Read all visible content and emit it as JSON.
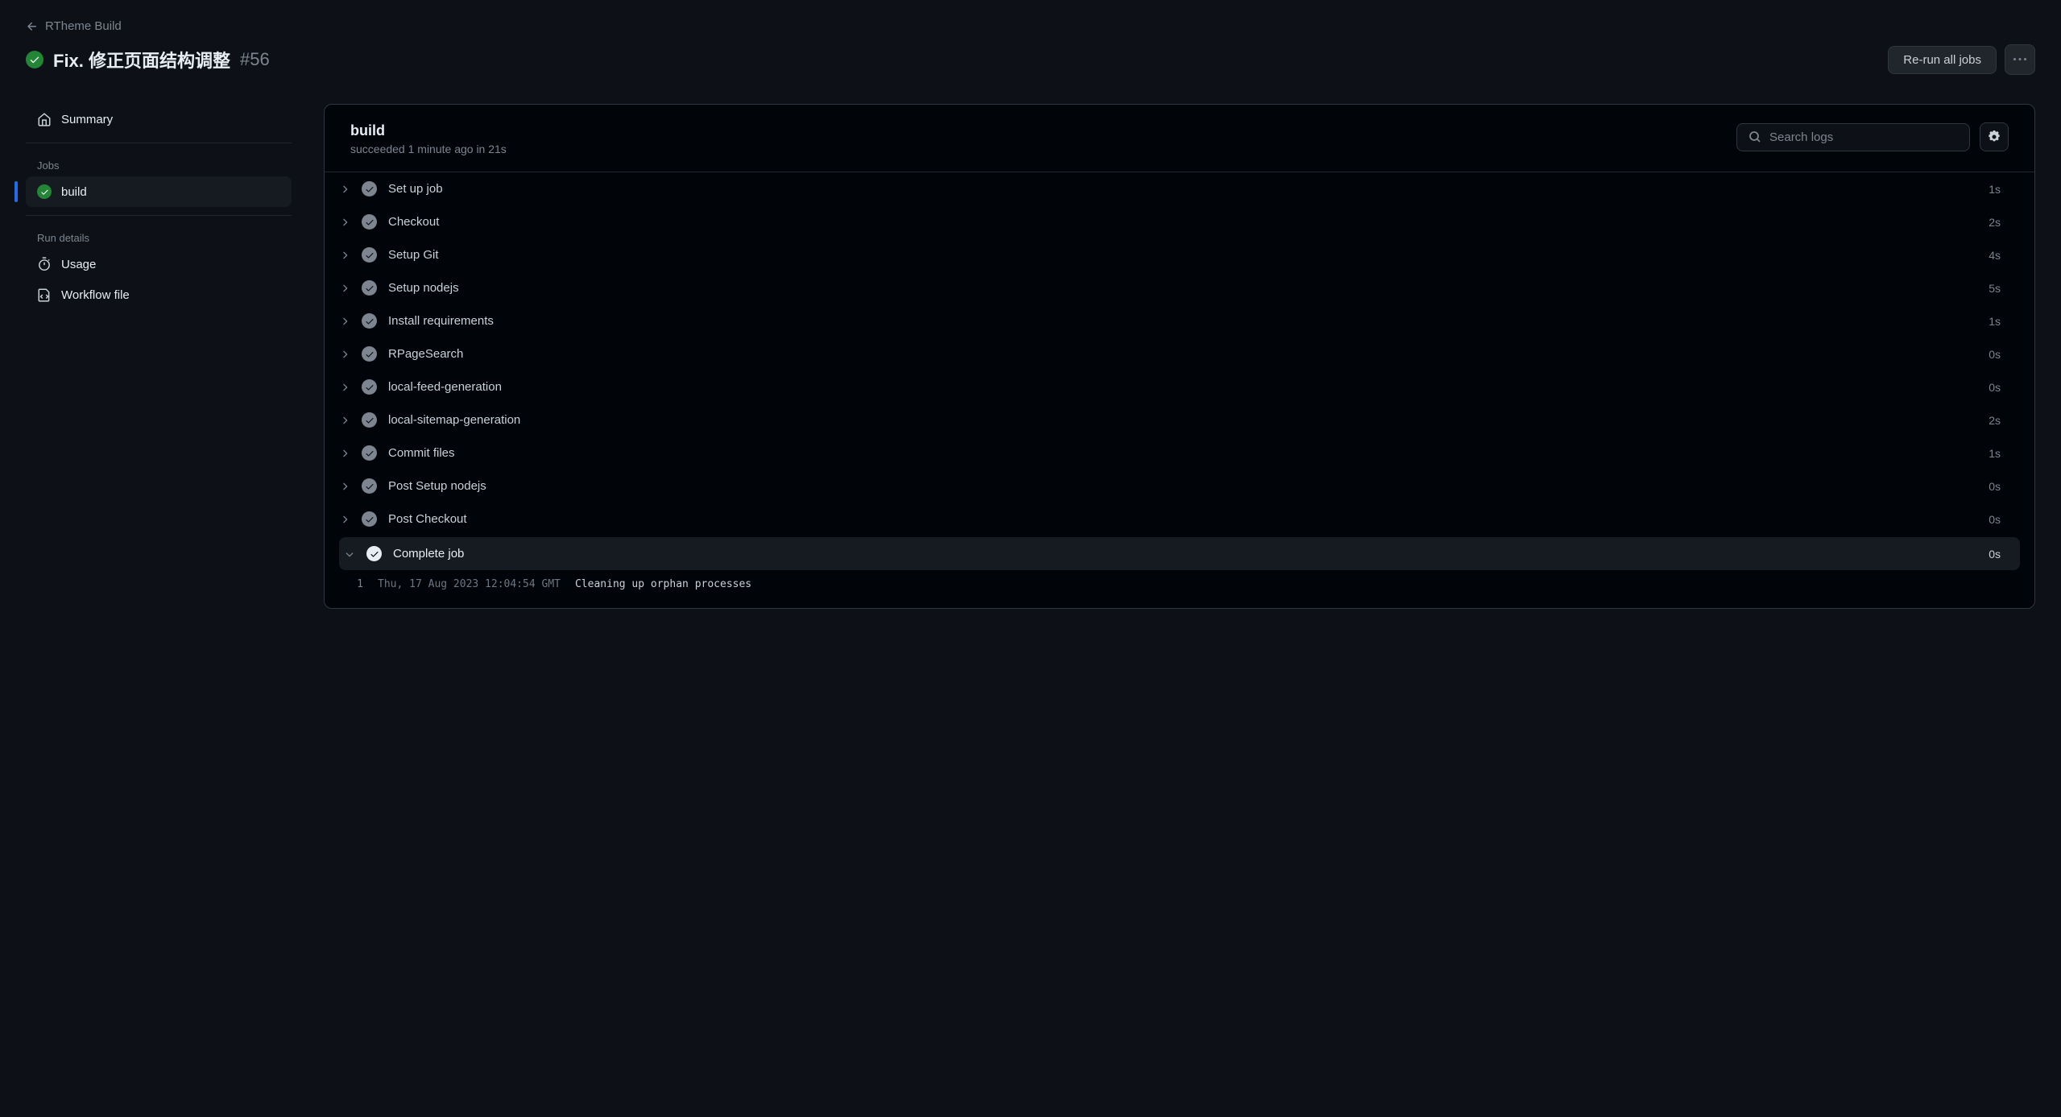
{
  "breadcrumb": {
    "label": "RTheme Build"
  },
  "title": {
    "text": "Fix. 修正页面结构调整",
    "number": "#56"
  },
  "actions": {
    "rerun": "Re-run all jobs"
  },
  "sidebar": {
    "summary": "Summary",
    "jobs_label": "Jobs",
    "jobs": [
      {
        "name": "build"
      }
    ],
    "details_label": "Run details",
    "usage": "Usage",
    "workflow_file": "Workflow file"
  },
  "main": {
    "title": "build",
    "subtitle": "succeeded 1 minute ago in 21s",
    "search_placeholder": "Search logs",
    "steps": [
      {
        "name": "Set up job",
        "time": "1s",
        "expanded": false
      },
      {
        "name": "Checkout",
        "time": "2s",
        "expanded": false
      },
      {
        "name": "Setup Git",
        "time": "4s",
        "expanded": false
      },
      {
        "name": "Setup nodejs",
        "time": "5s",
        "expanded": false
      },
      {
        "name": "Install requirements",
        "time": "1s",
        "expanded": false
      },
      {
        "name": "RPageSearch",
        "time": "0s",
        "expanded": false
      },
      {
        "name": "local-feed-generation",
        "time": "0s",
        "expanded": false
      },
      {
        "name": "local-sitemap-generation",
        "time": "2s",
        "expanded": false
      },
      {
        "name": "Commit files",
        "time": "1s",
        "expanded": false
      },
      {
        "name": "Post Setup nodejs",
        "time": "0s",
        "expanded": false
      },
      {
        "name": "Post Checkout",
        "time": "0s",
        "expanded": false
      },
      {
        "name": "Complete job",
        "time": "0s",
        "expanded": true
      }
    ],
    "log": {
      "num": "1",
      "ts": "Thu, 17 Aug 2023 12:04:54 GMT",
      "msg": "Cleaning up orphan processes"
    }
  }
}
